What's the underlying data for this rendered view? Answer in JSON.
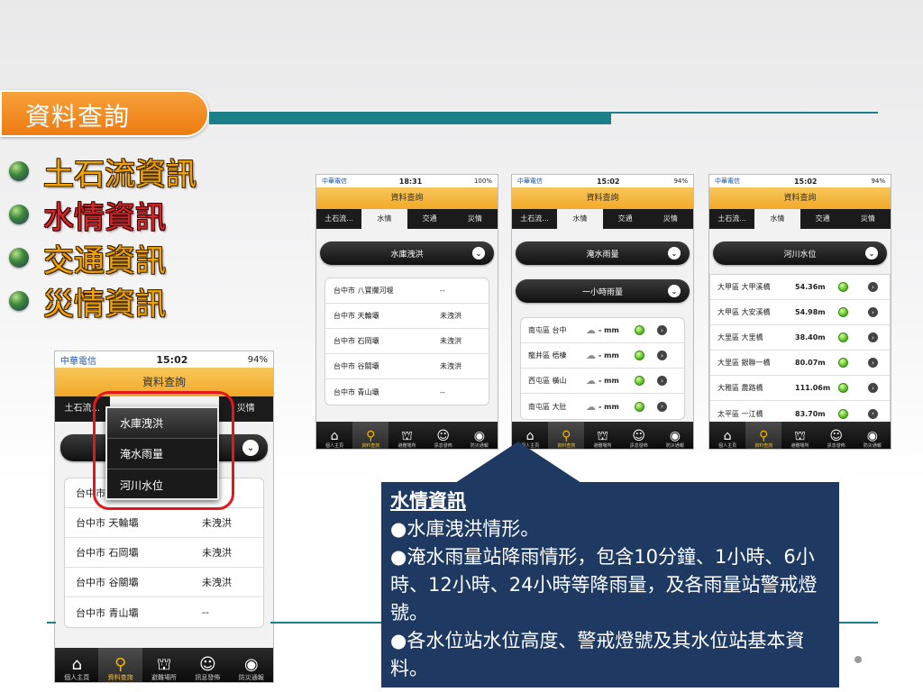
{
  "slide": {
    "title": "資料查詢",
    "bullets": [
      {
        "label": "土石流資訊",
        "highlight": false
      },
      {
        "label": "水情資訊",
        "highlight": true
      },
      {
        "label": "交通資訊",
        "highlight": false
      },
      {
        "label": "災情資訊",
        "highlight": false
      }
    ],
    "colors": {
      "accent_orange": "#ee7a10",
      "teal": "#1a7f86",
      "callout_bg": "#1e3a63",
      "highlight_red": "#d7262a",
      "bullet_gold": "#f2a300"
    }
  },
  "common": {
    "app_title": "資料查詢",
    "carrier": "中華電信",
    "tabs": [
      "土石流...",
      "水情",
      "交通",
      "災情"
    ],
    "toolbar": [
      {
        "label": "個人主頁",
        "icon": "home-icon"
      },
      {
        "label": "資料查詢",
        "icon": "search-icon"
      },
      {
        "label": "避難場所",
        "icon": "shelter-icon"
      },
      {
        "label": "訊息發佈",
        "icon": "chat-icon"
      },
      {
        "label": "防災通報",
        "icon": "alert-icon"
      }
    ]
  },
  "phone_large": {
    "time": "15:02",
    "battery": "94%",
    "tabs_left": "土石流...",
    "tabs_right": "災情",
    "menu_options": [
      "水庫洩洪",
      "淹水雨量",
      "河川水位"
    ],
    "rows": [
      {
        "name": "台中市 八寶攔河堰",
        "status": ""
      },
      {
        "name": "台中市 天輪壩",
        "status": "未洩洪"
      },
      {
        "name": "台中市 石岡壩",
        "status": "未洩洪"
      },
      {
        "name": "台中市 谷關壩",
        "status": "未洩洪"
      },
      {
        "name": "台中市 青山壩",
        "status": "--"
      }
    ]
  },
  "phone1": {
    "time": "18:31",
    "battery": "100%",
    "dropdown": "水庫洩洪",
    "rows": [
      {
        "name": "台中市 八寶攔河堰",
        "status": "--"
      },
      {
        "name": "台中市 天輪壩",
        "status": "未洩洪"
      },
      {
        "name": "台中市 石岡壩",
        "status": "未洩洪"
      },
      {
        "name": "台中市 谷關壩",
        "status": "未洩洪"
      },
      {
        "name": "台中市 青山壩",
        "status": "--"
      }
    ]
  },
  "phone2": {
    "time": "15:02",
    "battery": "94%",
    "dropdown1": "淹水雨量",
    "dropdown2": "一小時雨量",
    "rows": [
      {
        "name": "南屯區 台中",
        "value": "- mm"
      },
      {
        "name": "龍井區 梧棲",
        "value": "- mm"
      },
      {
        "name": "西屯區 橫山",
        "value": "- mm"
      },
      {
        "name": "南屯區 大肚",
        "value": "- mm"
      }
    ]
  },
  "phone3": {
    "time": "15:02",
    "battery": "94%",
    "dropdown": "河川水位",
    "rows": [
      {
        "name": "大甲區 大甲溪橋",
        "value": "54.36m"
      },
      {
        "name": "大甲區 大安溪橋",
        "value": "54.98m"
      },
      {
        "name": "大里區 大里橋",
        "value": "38.40m"
      },
      {
        "name": "大里區 銀聯一橋",
        "value": "80.07m"
      },
      {
        "name": "大雅區 農路橋",
        "value": "111.06m"
      },
      {
        "name": "太平區 一江橋",
        "value": "83.70m"
      }
    ]
  },
  "callout": {
    "heading": "水情資訊",
    "lines": [
      "●水庫洩洪情形。",
      "●淹水雨量站降雨情形，包含10分鐘、1小時、6小時、12小時、24小時等降雨量，及各雨量站警戒燈號。",
      "●各水位站水位高度、警戒燈號及其水位站基本資料。"
    ]
  }
}
